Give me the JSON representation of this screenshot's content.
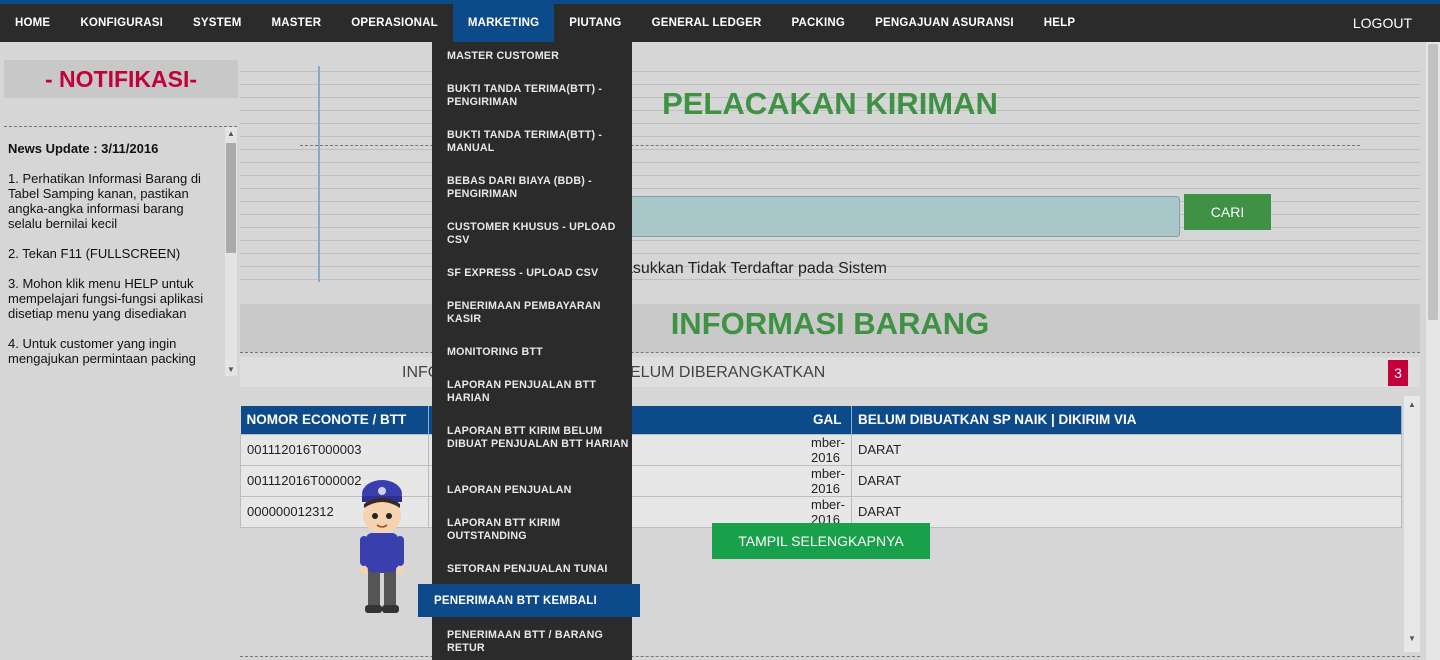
{
  "nav": {
    "items": [
      "HOME",
      "KONFIGURASI",
      "SYSTEM",
      "MASTER",
      "OPERASIONAL",
      "MARKETING",
      "PIUTANG",
      "GENERAL LEDGER",
      "PACKING",
      "PENGAJUAN ASURANSI",
      "HELP"
    ],
    "active": "MARKETING",
    "logout": "LOGOUT"
  },
  "notif": {
    "title": "- NOTIFIKASI-",
    "news_title": "News Update : 3/11/2016",
    "items": [
      "1. Perhatikan Informasi Barang di Tabel Samping kanan, pastikan angka-angka informasi barang selalu bernilai kecil",
      "2. Tekan F11 (FULLSCREEN)",
      "3. Mohon klik menu HELP untuk mempelajari fungsi-fungsi aplikasi disetiap menu yang disediakan",
      "4. Untuk customer yang ingin mengajukan permintaan packing"
    ]
  },
  "tracking": {
    "title": "PELACAKAN KIRIMAN",
    "search_value": "",
    "search_button": "CARI",
    "message": "asukkan Tidak Terdaftar pada Sistem"
  },
  "info": {
    "title": "INFORMASI BARANG",
    "subtitle_left": "INFO",
    "subtitle_right": "ELUM DIBERANGKATKAN",
    "badge": "3",
    "columns": [
      "NOMOR ECONOTE / BTT",
      "GAL",
      "BELUM DIBUATKAN SP NAIK | DIKIRIM VIA"
    ],
    "rows": [
      [
        "001112016T000003",
        "mber-2016",
        "DARAT"
      ],
      [
        "001112016T000002",
        "mber-2016",
        "DARAT"
      ],
      [
        "000000012312",
        "mber-2016",
        "DARAT"
      ]
    ],
    "more_button": "TAMPIL SELENGKAPNYA"
  },
  "dropdown": {
    "items": [
      "MASTER CUSTOMER",
      "BUKTI TANDA TERIMA(BTT) - PENGIRIMAN",
      "BUKTI TANDA TERIMA(BTT) - MANUAL",
      "BEBAS DARI BIAYA (BDB) - PENGIRIMAN",
      "CUSTOMER KHUSUS - UPLOAD CSV",
      "SF EXPRESS - UPLOAD CSV",
      "PENERIMAAN PEMBAYARAN KASIR",
      "MONITORING BTT",
      "LAPORAN PENJUALAN BTT HARIAN",
      "LAPORAN BTT KIRIM BELUM DIBUAT PENJUALAN BTT HARIAN",
      "LAPORAN PENJUALAN",
      "LAPORAN BTT KIRIM OUTSTANDING",
      "SETORAN PENJUALAN TUNAI",
      "PENERIMAAN BTT KEMBALI",
      "PENERIMAAN BTT / BARANG RETUR"
    ],
    "active": "PENERIMAAN BTT KEMBALI"
  },
  "colors": {
    "nav_bg": "#2b2b2b",
    "accent": "#0d4a8a",
    "green": "#3f9143",
    "alert": "#c4003a"
  }
}
